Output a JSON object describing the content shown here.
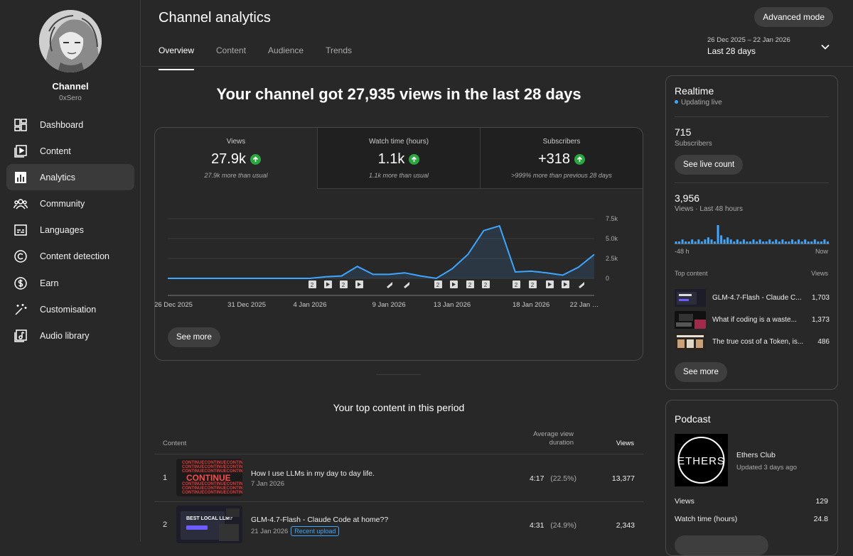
{
  "sidebar": {
    "channel_name": "Channel",
    "channel_handle": "0xSero",
    "items": [
      {
        "label": "Dashboard",
        "icon": "dashboard-icon"
      },
      {
        "label": "Content",
        "icon": "content-icon"
      },
      {
        "label": "Analytics",
        "icon": "analytics-icon",
        "active": true
      },
      {
        "label": "Community",
        "icon": "community-icon"
      },
      {
        "label": "Languages",
        "icon": "languages-icon"
      },
      {
        "label": "Content detection",
        "icon": "copyright-icon"
      },
      {
        "label": "Earn",
        "icon": "dollar-icon"
      },
      {
        "label": "Customisation",
        "icon": "wand-icon"
      },
      {
        "label": "Audio library",
        "icon": "music-icon"
      }
    ]
  },
  "header": {
    "title": "Channel analytics",
    "advanced_label": "Advanced mode",
    "tabs": [
      "Overview",
      "Content",
      "Audience",
      "Trends"
    ],
    "date_range": "26 Dec 2025 – 22 Jan 2026",
    "date_label": "Last 28 days"
  },
  "overview": {
    "headline": "Your channel got 27,935 views in the last 28 days",
    "stats": [
      {
        "label": "Views",
        "value": "27.9k",
        "sub": "27.9k more than usual"
      },
      {
        "label": "Watch time (hours)",
        "value": "1.1k",
        "sub": "1.1k more than usual"
      },
      {
        "label": "Subscribers",
        "value": "+318",
        "sub": ">999% more than previous 28 days"
      }
    ],
    "see_more": "See more"
  },
  "chart_data": {
    "type": "line",
    "x": [
      "26 Dec",
      "27 Dec",
      "28 Dec",
      "29 Dec",
      "30 Dec",
      "31 Dec",
      "1 Jan",
      "2 Jan",
      "3 Jan",
      "4 Jan",
      "5 Jan",
      "6 Jan",
      "7 Jan",
      "8 Jan",
      "9 Jan",
      "10 Jan",
      "11 Jan",
      "12 Jan",
      "13 Jan",
      "14 Jan",
      "15 Jan",
      "16 Jan",
      "17 Jan",
      "18 Jan",
      "19 Jan",
      "20 Jan",
      "21 Jan",
      "22 Jan"
    ],
    "series": [
      {
        "values": [
          0,
          0,
          0,
          0,
          0,
          0,
          0,
          0,
          0,
          0,
          200,
          300,
          1500,
          500,
          500,
          700,
          300,
          0,
          1200,
          3000,
          6000,
          6600,
          800,
          900,
          700,
          400,
          1400,
          3000
        ]
      }
    ],
    "x_tick_labels": [
      "26 Dec 2025",
      "31 Dec 2025",
      "4 Jan 2026",
      "9 Jan 2026",
      "13 Jan 2026",
      "18 Jan 2026",
      "22 Jan …"
    ],
    "y_ticks": [
      "7.5k",
      "5.0k",
      "2.5k",
      "0"
    ],
    "ylim": [
      0,
      7500
    ],
    "grid": true,
    "color": "#3ea6ff"
  },
  "top_content": {
    "title": "Your top content in this period",
    "col_content": "Content",
    "col_avd": "Average view duration",
    "col_views": "Views",
    "rows": [
      {
        "rank": "1",
        "title": "How I use LLMs in my day to day life.",
        "date": "7 Jan 2026",
        "avd": "4:17",
        "avd_pct": "(22.5%)",
        "views": "13,377",
        "badge": ""
      },
      {
        "rank": "2",
        "title": "GLM-4.7-Flash - Claude Code at home??",
        "date": "21 Jan 2026",
        "avd": "4:31",
        "avd_pct": "(24.9%)",
        "views": "2,343",
        "badge": "Recent upload"
      }
    ],
    "thumb1_text": "CONTINUE",
    "thumb2_text": "BEST LOCAL LLM?"
  },
  "realtime": {
    "title": "Realtime",
    "updating": "Updating live",
    "subs_value": "715",
    "subs_label": "Subscribers",
    "see_live": "See live count",
    "views_value": "3,956",
    "views_label": "Views · Last 48 hours",
    "axis_left": "-48 h",
    "axis_right": "Now",
    "top_content_label": "Top content",
    "views_col": "Views",
    "items": [
      {
        "title": "GLM-4.7-Flash - Claude C...",
        "views": "1,703"
      },
      {
        "title": "What if coding is a waste...",
        "views": "1,373"
      },
      {
        "title": "The true cost of a Token, is...",
        "views": "486"
      }
    ],
    "bars": [
      1,
      1,
      2,
      1,
      1,
      2,
      1,
      2,
      1,
      2,
      3,
      2,
      1,
      9,
      4,
      2,
      3,
      2,
      1,
      2,
      1,
      2,
      1,
      1,
      2,
      1,
      2,
      1,
      1,
      2,
      1,
      2,
      1,
      2,
      1,
      1,
      2,
      1,
      2,
      1,
      2,
      1,
      1,
      2,
      1,
      1,
      2,
      1
    ],
    "see_more": "See more"
  },
  "podcast": {
    "title": "Podcast",
    "name": "Ethers Club",
    "updated": "Updated 3 days ago",
    "logo_text": "ETHERS",
    "views_label": "Views",
    "views_value": "129",
    "watch_label": "Watch time (hours)",
    "watch_value": "24.8"
  }
}
